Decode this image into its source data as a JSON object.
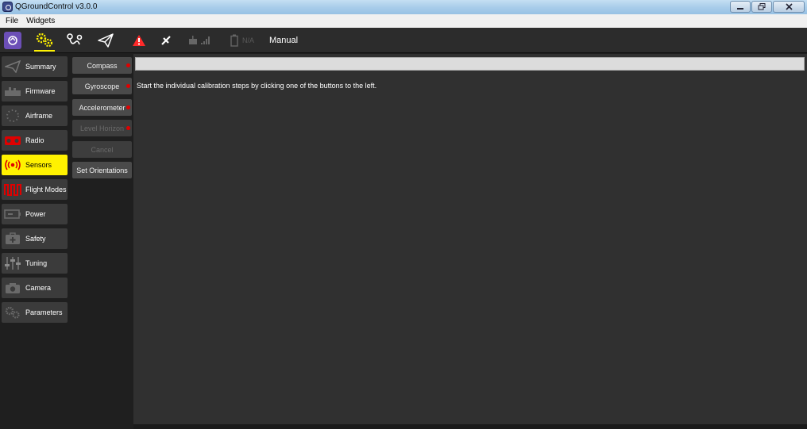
{
  "window": {
    "title": "QGroundControl v3.0.0",
    "controls": [
      "minimize-icon",
      "restore-icon",
      "close-icon"
    ]
  },
  "menu": {
    "items": [
      "File",
      "Widgets"
    ]
  },
  "toolbar": {
    "icons": [
      "qgc-logo-icon",
      "setup-gears-icon",
      "plan-waypoint-icon",
      "fly-paper-plane-icon",
      "warning-icon",
      "gps-satellite-icon",
      "rc-signal-icon",
      "battery-icon"
    ],
    "battery_text": "N/A",
    "flight_mode": "Manual",
    "active_tab": "setup",
    "colors": {
      "accent": "#fff200",
      "warning": "#ff2a2a",
      "logo": "#6c4fb7"
    }
  },
  "sidebar": {
    "items": [
      {
        "label": "Summary",
        "icon": "paper-plane-icon"
      },
      {
        "label": "Firmware",
        "icon": "firmware-board-icon"
      },
      {
        "label": "Airframe",
        "icon": "airframe-icon"
      },
      {
        "label": "Radio",
        "icon": "radio-controller-icon"
      },
      {
        "label": "Sensors",
        "icon": "sensor-waves-icon",
        "active": true
      },
      {
        "label": "Flight Modes",
        "icon": "flight-modes-icon"
      },
      {
        "label": "Power",
        "icon": "battery-power-icon"
      },
      {
        "label": "Safety",
        "icon": "first-aid-kit-icon"
      },
      {
        "label": "Tuning",
        "icon": "tuning-sliders-icon"
      },
      {
        "label": "Camera",
        "icon": "camera-icon"
      },
      {
        "label": "Parameters",
        "icon": "gears-icon"
      }
    ],
    "active_color": "#fff200"
  },
  "sensors": {
    "buttons": [
      {
        "label": "Compass",
        "needs_calibration": true,
        "enabled": true
      },
      {
        "label": "Gyroscope",
        "needs_calibration": true,
        "enabled": true
      },
      {
        "label": "Accelerometer",
        "needs_calibration": true,
        "enabled": true
      },
      {
        "label": "Level Horizon",
        "needs_calibration": true,
        "enabled": false
      },
      {
        "label": "Cancel",
        "needs_calibration": false,
        "enabled": false
      },
      {
        "label": "Set Orientations",
        "needs_calibration": false,
        "enabled": true
      }
    ],
    "status_color": "#e00000"
  },
  "main": {
    "progress": 0,
    "instruction": "Start the individual calibration steps by clicking one of the buttons to the left."
  }
}
